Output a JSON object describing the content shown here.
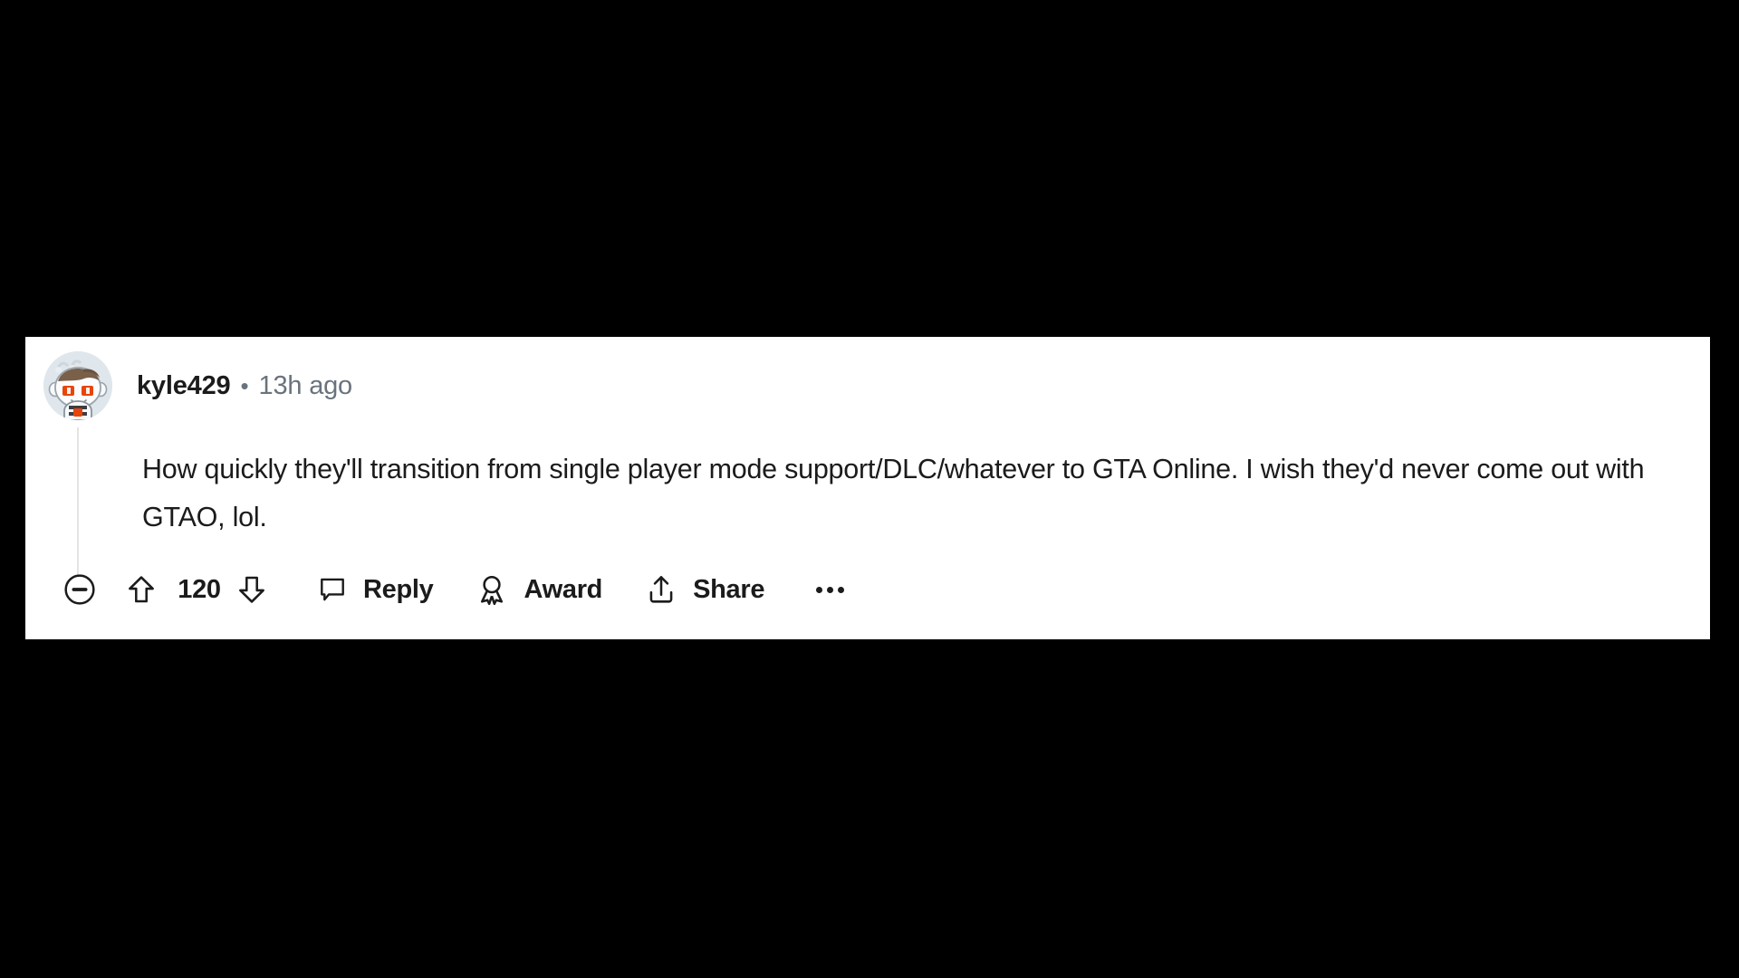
{
  "comment": {
    "author": "kyle429",
    "separator": "•",
    "timestamp": "13h ago",
    "body": "How quickly they'll transition from single player mode support/DLC/whatever to GTA Online. I wish they'd never come out with GTAO, lol."
  },
  "actions": {
    "collapse_label": "",
    "upvote_label": "",
    "vote_count": "120",
    "downvote_label": "",
    "reply_label": "Reply",
    "award_label": "Award",
    "share_label": "Share",
    "more_label": ""
  },
  "colors": {
    "page_background": "#000000",
    "card_background": "#ffffff",
    "primary_text": "#1b1b1b",
    "muted_text": "#6a737c",
    "thread_line": "#e2e4e7",
    "avatar_background": "#dfe6ec",
    "avatar_hair": "#7a6049",
    "avatar_eyes": "#e8450a"
  }
}
